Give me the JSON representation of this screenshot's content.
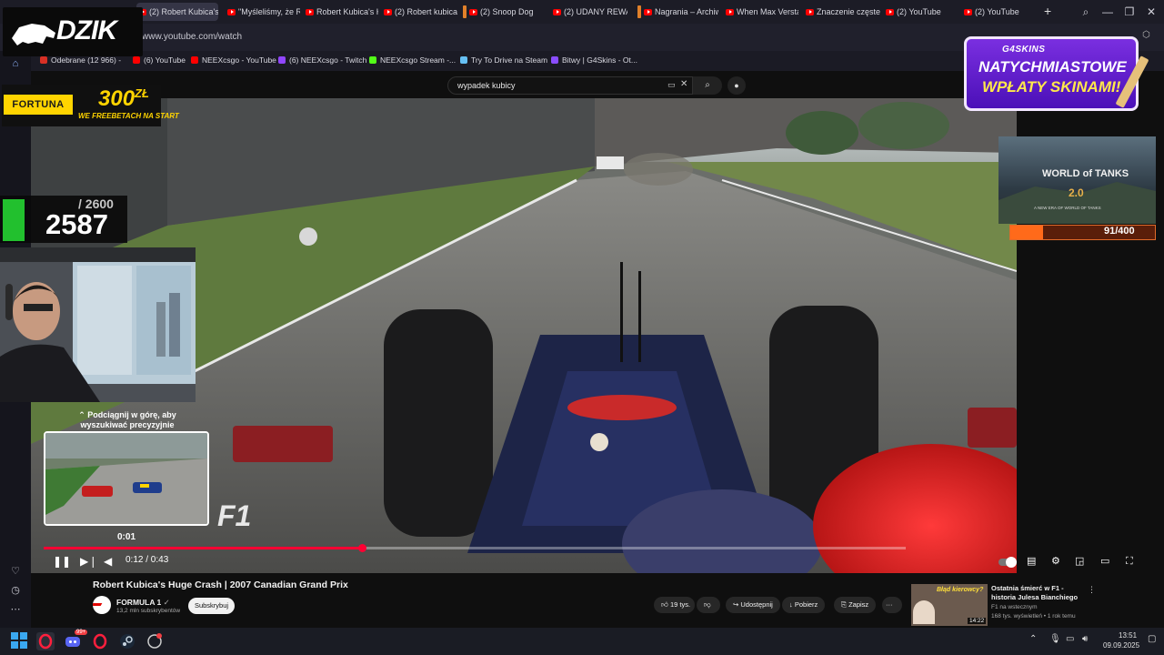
{
  "browser": {
    "tabs": [
      {
        "label": "(2) Robert Kubica's Hu",
        "active": true
      },
      {
        "label": "\"Myśleliśmy, że Ro"
      },
      {
        "label": "Robert Kubica's Hu"
      },
      {
        "label": "(2) Robert kubica"
      },
      {
        "label": "(2) Snoop Dog"
      },
      {
        "label": "(2) UDANY REWAN"
      },
      {
        "label": "Nagrania – Archiw"
      },
      {
        "label": "When Max Verstap"
      },
      {
        "label": "Znaczenie częstego"
      },
      {
        "label": "(2) YouTube"
      },
      {
        "label": "(2) YouTube"
      }
    ],
    "new_tab": "+",
    "url": "www.youtube.com/watch",
    "bookmarks": [
      {
        "label": "Odebrane (12 966) -",
        "color": "#d93025"
      },
      {
        "label": "(6) YouTube",
        "color": "#ff0000"
      },
      {
        "label": "NEEXcsgo - YouTube",
        "color": "#ff0000"
      },
      {
        "label": "(6) NEEXcsgo - Twitch",
        "color": "#9146ff"
      },
      {
        "label": "NEEXcsgo Stream -...",
        "color": "#53fc18"
      },
      {
        "label": "Try To Drive na Steam",
        "color": "#66c0f4"
      },
      {
        "label": "Bitwy | G4Skins - Ot...",
        "color": "#8a4dff"
      }
    ]
  },
  "youtube": {
    "search_query": "wypadek kubicy",
    "player": {
      "time": "0:12 / 0:43",
      "progress": 0.28,
      "seek_hint": "Podciągnij w górę, aby wyszukiwać precyzyjnie",
      "seek_time": "0:01"
    },
    "video": {
      "title": "Robert Kubica's Huge Crash | 2007 Canadian Grand Prix",
      "channel": "FORMULA 1",
      "subscribers": "13,2 mln subskrybentów",
      "subscribe_label": "Subskrybuj",
      "likes": "19 tys.",
      "share_label": "Udostępnij",
      "download_label": "Pobierz",
      "save_label": "Zapisz",
      "more_label": "···"
    },
    "recommended": {
      "title": "Ostatnia śmierć w F1 - historia Julesa Bianchiego",
      "channel": "F1 na wstecznym",
      "meta": "168 tys. wyświetleń • 1 rok temu",
      "duration": "14:22",
      "thumb_text": "Błąd kierowcy?"
    }
  },
  "overlays": {
    "dzik": "DZIK",
    "fortuna": {
      "logo": "FORTUNA",
      "amount": "300",
      "currency": "ZŁ",
      "sub": "WE FREEBETACH NA START"
    },
    "counter": {
      "value": "2587",
      "total": "/ 2600"
    },
    "g4skins": {
      "brand": "G4SKINS",
      "line1": "NATYCHMIASTOWE",
      "line2": "WPŁATY SKINAMI!"
    },
    "wot": {
      "title": "WORLD of TANKS",
      "version": "2.0",
      "subtitle": "A NEW ERA OF WORLD OF TANKS",
      "progress_text": "91/400",
      "progress": 0.2275
    }
  },
  "taskbar": {
    "time": "13:51",
    "date": "09.09.2025",
    "notif_badge": "99+"
  },
  "colors": {
    "yt_red": "#ff0033",
    "g4_purple": "#6a22d8",
    "fortuna_yellow": "#ffd400",
    "counter_green": "#22c02e"
  }
}
